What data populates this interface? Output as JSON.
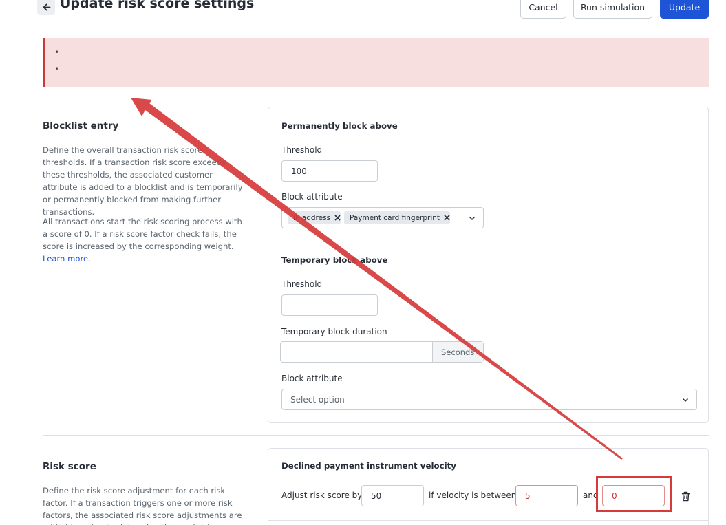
{
  "header": {
    "title": "Update risk score settings",
    "cancel_label": "Cancel",
    "simulation_label": "Run simulation",
    "update_label": "Update"
  },
  "error_banner": {
    "items": [
      "",
      ""
    ]
  },
  "blocklist": {
    "title": "Blocklist entry",
    "desc1": "Define the overall transaction risk score thresholds. If a transaction risk score exceeds these thresholds, the associated customer attribute is added to a blocklist and is temporarily or permanently blocked from making further transactions.",
    "desc2_text": "All transactions start the risk scoring process with a score of 0. If a risk score factor check fails, the score is increased by the corresponding weight. ",
    "desc2_link": "Learn more",
    "desc2_end": ".",
    "permanent": {
      "title": "Permanently block above",
      "threshold_label": "Threshold",
      "threshold_value": "100",
      "attribute_label": "Block attribute",
      "tags": [
        "IP address",
        "Payment card fingerprint"
      ]
    },
    "temporary": {
      "title": "Temporary block above",
      "threshold_label": "Threshold",
      "threshold_value": "",
      "duration_label": "Temporary block duration",
      "duration_value": "",
      "duration_unit": "Seconds",
      "attribute_label": "Block attribute",
      "attribute_placeholder": "Select option"
    }
  },
  "risk_score": {
    "title": "Risk score",
    "desc": "Define the risk score adjustment for each risk factor. If a transaction triggers one or more risk factors, the associated risk score adjustments are added together to determine the total risk score.",
    "factor": {
      "title": "Declined payment instrument velocity",
      "adjust_label": "Adjust risk score by",
      "adjust_value": "50",
      "between_label": "if velocity is between",
      "from_value": "5",
      "and_label": "and",
      "to_value": "0"
    }
  },
  "colors": {
    "primary": "#1e54d6",
    "error": "#c63a3a",
    "error_bg": "#f7dfe0",
    "annotation": "#d63a3a"
  }
}
